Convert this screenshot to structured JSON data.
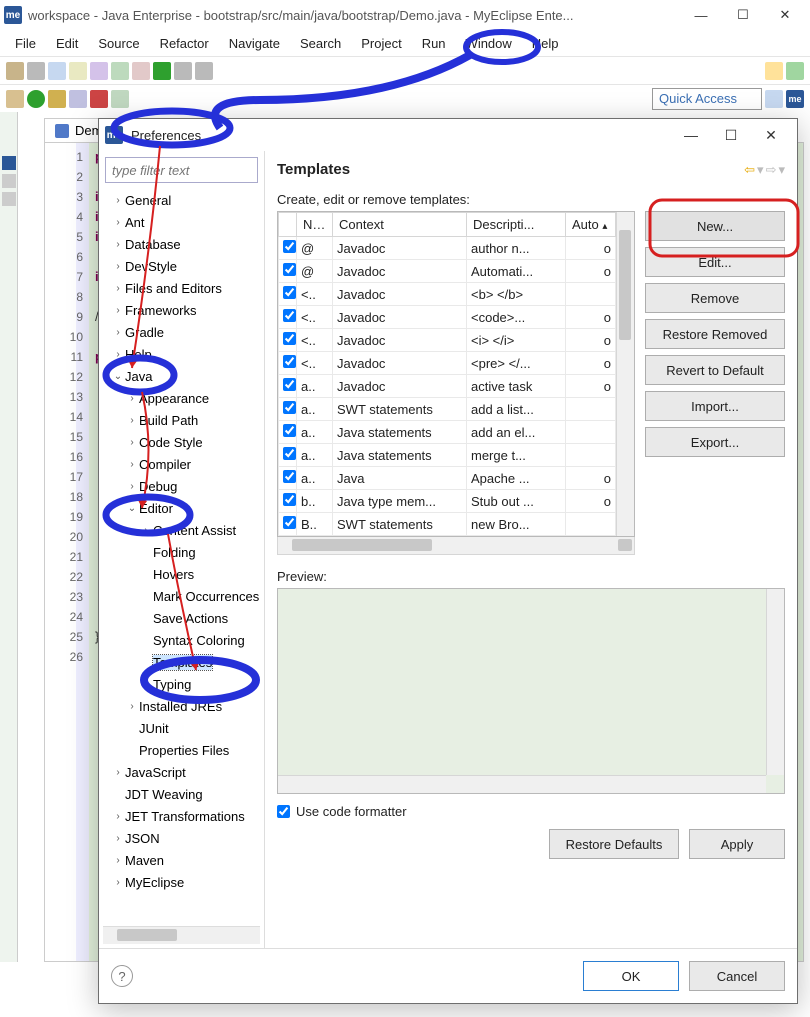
{
  "window": {
    "title": "workspace - Java Enterprise - bootstrap/src/main/java/bootstrap/Demo.java - MyEclipse Ente..."
  },
  "menubar": [
    "File",
    "Edit",
    "Source",
    "Refactor",
    "Navigate",
    "Search",
    "Project",
    "Run",
    "Window",
    "Help"
  ],
  "editor": {
    "tab": "Demo",
    "linenums": [
      "1",
      "2",
      "3",
      "4",
      "5",
      "6",
      "7",
      "8",
      "9",
      "10",
      "11",
      "12",
      "13",
      "14",
      "15",
      "16",
      "17",
      "18",
      "19",
      "20",
      "21",
      "22",
      "23",
      "24",
      "25",
      "26"
    ],
    "code_lines": [
      "pa",
      "",
      "im",
      "im",
      "im",
      "",
      "im",
      "",
      "/*",
      "",
      "pu",
      "",
      "",
      "",
      "",
      "",
      "",
      "",
      "",
      "",
      "",
      "",
      "",
      "",
      "}",
      ""
    ]
  },
  "quick_access": "Quick Access",
  "dialog": {
    "title": "Preferences",
    "filter_placeholder": "type filter text",
    "tree": [
      {
        "label": "General",
        "level": 1,
        "exp": "closed"
      },
      {
        "label": "Ant",
        "level": 1,
        "exp": "closed"
      },
      {
        "label": "Database",
        "level": 1,
        "exp": "closed"
      },
      {
        "label": "DevStyle",
        "level": 1,
        "exp": "closed"
      },
      {
        "label": "Files and Editors",
        "level": 1,
        "exp": "closed"
      },
      {
        "label": "Frameworks",
        "level": 1,
        "exp": "closed"
      },
      {
        "label": "Gradle",
        "level": 1,
        "exp": "closed"
      },
      {
        "label": "Help",
        "level": 1,
        "exp": "closed"
      },
      {
        "label": "Java",
        "level": 1,
        "exp": "open"
      },
      {
        "label": "Appearance",
        "level": 2,
        "exp": "closed"
      },
      {
        "label": "Build Path",
        "level": 2,
        "exp": "closed"
      },
      {
        "label": "Code Style",
        "level": 2,
        "exp": "closed"
      },
      {
        "label": "Compiler",
        "level": 2,
        "exp": "closed"
      },
      {
        "label": "Debug",
        "level": 2,
        "exp": "closed"
      },
      {
        "label": "Editor",
        "level": 2,
        "exp": "open"
      },
      {
        "label": "Content Assist",
        "level": 3,
        "exp": "closed"
      },
      {
        "label": "Folding",
        "level": 3,
        "exp": "none"
      },
      {
        "label": "Hovers",
        "level": 3,
        "exp": "none"
      },
      {
        "label": "Mark Occurrences",
        "level": 3,
        "exp": "none"
      },
      {
        "label": "Save Actions",
        "level": 3,
        "exp": "none"
      },
      {
        "label": "Syntax Coloring",
        "level": 3,
        "exp": "none"
      },
      {
        "label": "Templates",
        "level": 3,
        "exp": "none",
        "selected": true
      },
      {
        "label": "Typing",
        "level": 3,
        "exp": "none"
      },
      {
        "label": "Installed JREs",
        "level": 2,
        "exp": "closed"
      },
      {
        "label": "JUnit",
        "level": 2,
        "exp": "none"
      },
      {
        "label": "Properties Files",
        "level": 2,
        "exp": "none"
      },
      {
        "label": "JavaScript",
        "level": 1,
        "exp": "closed"
      },
      {
        "label": "JDT Weaving",
        "level": 1,
        "exp": "none"
      },
      {
        "label": "JET Transformations",
        "level": 1,
        "exp": "closed"
      },
      {
        "label": "JSON",
        "level": 1,
        "exp": "closed"
      },
      {
        "label": "Maven",
        "level": 1,
        "exp": "closed"
      },
      {
        "label": "MyEclipse",
        "level": 1,
        "exp": "closed"
      }
    ],
    "page_title": "Templates",
    "desc": "Create, edit or remove templates:",
    "columns": [
      "Na...",
      "Context",
      "Descripti...",
      "Auto"
    ],
    "rows": [
      {
        "chk": true,
        "name": "@",
        "ctx": "Javadoc",
        "desc": "author n...",
        "auto": "o"
      },
      {
        "chk": true,
        "name": "@",
        "ctx": "Javadoc",
        "desc": "Automati...",
        "auto": "o"
      },
      {
        "chk": true,
        "name": "<..",
        "ctx": "Javadoc",
        "desc": "<b> </b>",
        "auto": ""
      },
      {
        "chk": true,
        "name": "<..",
        "ctx": "Javadoc",
        "desc": "<code>...",
        "auto": "o"
      },
      {
        "chk": true,
        "name": "<..",
        "ctx": "Javadoc",
        "desc": "<i> </i>",
        "auto": "o"
      },
      {
        "chk": true,
        "name": "<..",
        "ctx": "Javadoc",
        "desc": "<pre> </...",
        "auto": "o"
      },
      {
        "chk": true,
        "name": "a..",
        "ctx": "Javadoc",
        "desc": "active task",
        "auto": "o"
      },
      {
        "chk": true,
        "name": "a..",
        "ctx": "SWT statements",
        "desc": "add a list...",
        "auto": ""
      },
      {
        "chk": true,
        "name": "a..",
        "ctx": "Java statements",
        "desc": "add an el...",
        "auto": ""
      },
      {
        "chk": true,
        "name": "a..",
        "ctx": "Java statements",
        "desc": "merge t...",
        "auto": ""
      },
      {
        "chk": true,
        "name": "a..",
        "ctx": "Java",
        "desc": "Apache ...",
        "auto": "o"
      },
      {
        "chk": true,
        "name": "b..",
        "ctx": "Java type mem...",
        "desc": "Stub out ...",
        "auto": "o"
      },
      {
        "chk": true,
        "name": "B..",
        "ctx": "SWT statements",
        "desc": "new Bro...",
        "auto": ""
      }
    ],
    "buttons": {
      "new": "New...",
      "edit": "Edit...",
      "remove": "Remove",
      "restore_removed": "Restore Removed",
      "revert": "Revert to Default",
      "import": "Import...",
      "export": "Export..."
    },
    "preview_label": "Preview:",
    "use_formatter": "Use code formatter",
    "restore_defaults": "Restore Defaults",
    "apply": "Apply",
    "ok": "OK",
    "cancel": "Cancel"
  }
}
